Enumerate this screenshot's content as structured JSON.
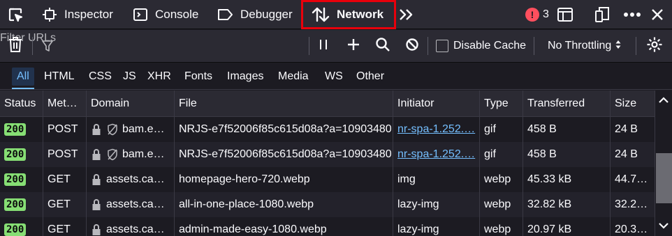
{
  "toolbar": {
    "tabs": [
      {
        "label": "Inspector"
      },
      {
        "label": "Console"
      },
      {
        "label": "Debugger"
      },
      {
        "label": "Network"
      }
    ],
    "error_count": "3",
    "error_glyph": "!"
  },
  "filterbar": {
    "filter_placeholder": "Filter URLs",
    "disable_cache_label": "Disable Cache",
    "throttling_label": "No Throttling"
  },
  "type_filters": [
    "All",
    "HTML",
    "CSS",
    "JS",
    "XHR",
    "Fonts",
    "Images",
    "Media",
    "WS",
    "Other"
  ],
  "table": {
    "columns": [
      "Status",
      "Met…",
      "Domain",
      "File",
      "Initiator",
      "Type",
      "Transferred",
      "Size"
    ],
    "rows": [
      {
        "status": "200",
        "method": "POST",
        "domain": "bam.e…",
        "file": "NRJS-e7f52006f85c615d08a?a=10903480!",
        "initiator": "nr-spa-1.252.…",
        "type": "gif",
        "transferred": "458 B",
        "size": "24 B"
      },
      {
        "status": "200",
        "method": "POST",
        "domain": "bam.e…",
        "file": "NRJS-e7f52006f85c615d08a?a=10903480!",
        "initiator": "nr-spa-1.252.…",
        "type": "gif",
        "transferred": "458 B",
        "size": "24 B"
      },
      {
        "status": "200",
        "method": "GET",
        "domain": "assets.ca…",
        "file": "homepage-hero-720.webp",
        "initiator": "img",
        "type": "webp",
        "transferred": "45.33 kB",
        "size": "44.7…"
      },
      {
        "status": "200",
        "method": "GET",
        "domain": "assets.ca…",
        "file": "all-in-one-place-1080.webp",
        "initiator": "lazy-img",
        "type": "webp",
        "transferred": "32.82 kB",
        "size": "32.2…"
      },
      {
        "status": "200",
        "method": "GET",
        "domain": "assets.ca…",
        "file": "admin-made-easy-1080.webp",
        "initiator": "lazy-img",
        "type": "webp",
        "transferred": "20.97 kB",
        "size": "20.3…"
      }
    ]
  }
}
